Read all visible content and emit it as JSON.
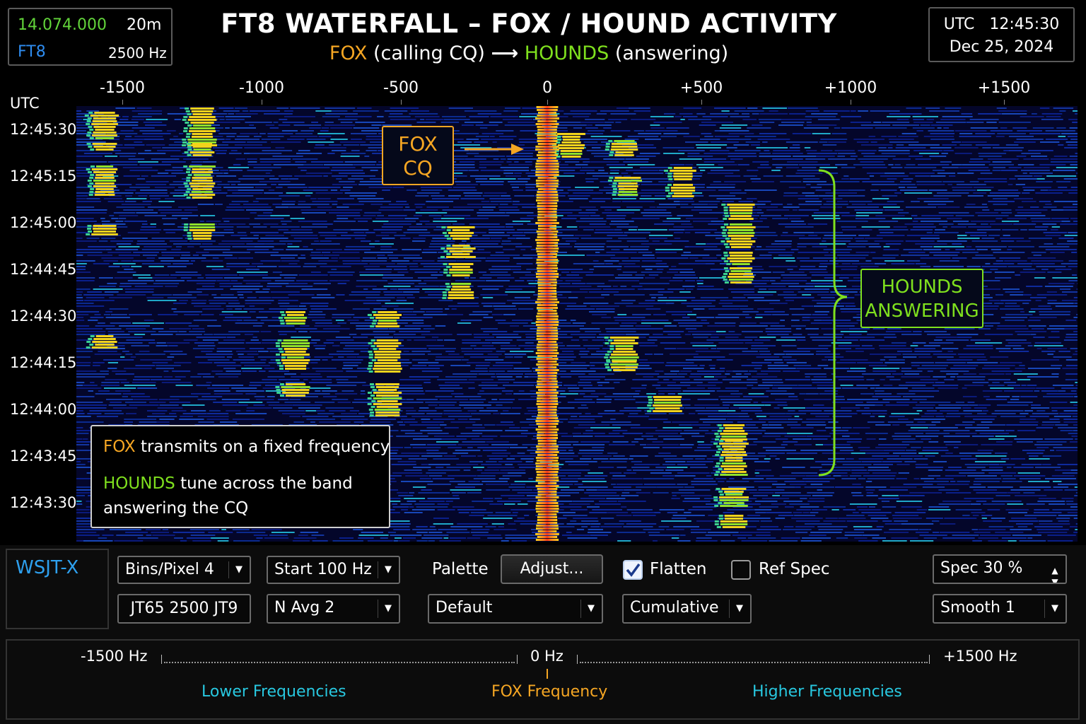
{
  "header": {
    "frequency": "14.074.000",
    "band": "20m",
    "mode": "FT8",
    "bandwidth": "2500 Hz",
    "title": "FT8 WATERFALL – FOX / HOUND ACTIVITY",
    "subtitle": {
      "fox": "FOX",
      "fox_note": "(calling CQ)",
      "arrow": "⟶",
      "hounds": "HOUNDS",
      "hounds_note": "(answering)"
    },
    "utc_label": "UTC",
    "utc_time": "12:45:30",
    "date": "Dec 25, 2024"
  },
  "axis": {
    "utc_label": "UTC",
    "freq_ticks": [
      "-1500",
      "-1000",
      "-500",
      "0",
      "+500",
      "+1000",
      "+1500"
    ],
    "time_labels": [
      "12:45:30",
      "12:45:15",
      "12:45:00",
      "12:44:45",
      "12:44:30",
      "12:44:15",
      "12:44:00",
      "12:43:45",
      "12:43:30"
    ]
  },
  "annotations": {
    "fox_cq_line1": "FOX",
    "fox_cq_line2": "CQ",
    "hounds_line1": "HOUNDS",
    "hounds_line2": "ANSWERING",
    "info_fox": "FOX",
    "info_fox_text": "transmits on a fixed frequency",
    "info_hounds": "HOUNDS",
    "info_hounds_text": "tune across the band",
    "info_line3": "answering the CQ"
  },
  "controls": {
    "app_name": "WSJT-X",
    "bins_per_pixel": "Bins/Pixel 4",
    "start": "Start 100 Hz",
    "palette_label": "Palette",
    "adjust_button": "Adjust...",
    "flatten_label": "Flatten",
    "flatten_checked": true,
    "ref_spec_label": "Ref Spec",
    "ref_spec_checked": false,
    "spec": "Spec 30 %",
    "mode_button": "JT65 2500 JT9",
    "n_avg": "N Avg 2",
    "palette_value": "Default",
    "display_mode": "Cumulative",
    "smooth": "Smooth 1"
  },
  "scale": {
    "left": "-1500 Hz",
    "center": "0 Hz",
    "right": "+1500 Hz",
    "lower_caption": "Lower Frequencies",
    "center_caption": "FOX Frequency",
    "higher_caption": "Higher Frequencies"
  },
  "colors": {
    "fox": "#f5a623",
    "hound": "#7fe01e",
    "accent_blue": "#2ea0ee",
    "cyan": "#28c8e0",
    "background": "#000000"
  },
  "icons": {
    "dropdown": "chevron-down-icon",
    "checkbox": "checkmark-icon",
    "spinner": "spinner-arrows-icon",
    "arrow": "arrow-right-icon"
  }
}
